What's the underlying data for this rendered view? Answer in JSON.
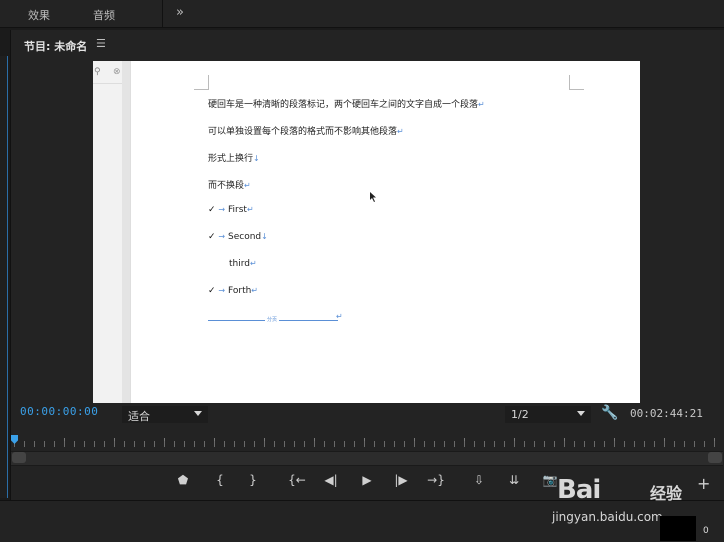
{
  "top_tabs": [
    "效果",
    "音频"
  ],
  "top_more": "»",
  "panel": {
    "title": "节目: 未命名",
    "menu": "☰"
  },
  "document": {
    "lines": [
      "硬回车是一种清晰的段落标记，两个硬回车之间的文字自成一个段落",
      "可以单独设置每个段落的格式而不影响其他段落",
      "形式上换行",
      "而不换段",
      "First",
      "Second",
      "third",
      "Forth"
    ],
    "rule_label": "分页",
    "para_mark": "↵",
    "soft_mark": "↓",
    "check": "✓",
    "tab_arrow": "→",
    "search_icon": "🔍",
    "close_icon": "⊗"
  },
  "controls": {
    "timecode_current": "00:00:00:00",
    "fit": "适合",
    "resolution": "1/2",
    "timecode_total": "00:02:44:21"
  },
  "transport": {
    "marker": "⬟",
    "in": "{",
    "out": "}",
    "goto_in": "{←",
    "step_back": "◀|",
    "play": "▶",
    "step_fwd": "|▶",
    "goto_out": "→}",
    "insert": "⇩",
    "overwrite": "⇊",
    "export_frame": "📷",
    "add": "+"
  },
  "watermark": {
    "brand": "Bai",
    "brand2": "经验",
    "url": "jingyan.baidu.com",
    "zero": "0"
  },
  "colors": {
    "accent": "#3aa0e8",
    "para_mark": "#5a8fd6"
  }
}
